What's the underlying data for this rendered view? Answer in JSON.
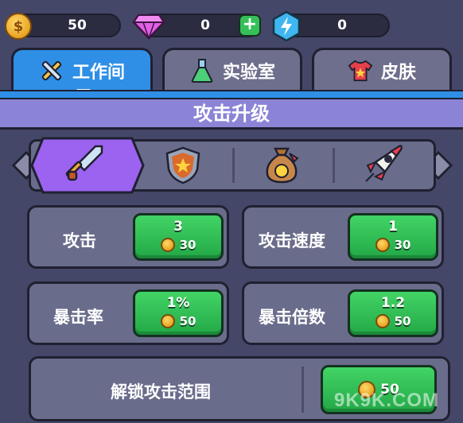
{
  "currency": {
    "coins": "50",
    "gems": "0",
    "energy": "0",
    "coin_symbol": "$"
  },
  "tabs": [
    {
      "label": "工作间",
      "icon": "tools-icon",
      "active": true
    },
    {
      "label": "实验室",
      "icon": "flask-icon",
      "active": false
    },
    {
      "label": "皮肤",
      "icon": "shirt-icon",
      "active": false
    }
  ],
  "section_title": "攻击升级",
  "categories": [
    {
      "icon": "sword-icon",
      "active": true
    },
    {
      "icon": "shield-icon",
      "active": false
    },
    {
      "icon": "money-bag-icon",
      "active": false
    },
    {
      "icon": "rocket-icon",
      "active": false
    }
  ],
  "upgrades": [
    {
      "label": "攻击",
      "level": "3",
      "cost": "30"
    },
    {
      "label": "攻击速度",
      "level": "1",
      "cost": "30"
    },
    {
      "label": "暴击率",
      "level": "1%",
      "cost": "50"
    },
    {
      "label": "暴击倍数",
      "level": "1.2",
      "cost": "50"
    }
  ],
  "unlock": {
    "label": "解锁攻击范围",
    "cost": "50"
  },
  "watermark": "9K9K.COM",
  "colors": {
    "tab_active": "#2f8fe6",
    "title_band": "#8b84d6",
    "button_green": "#36c05a",
    "panel": "#6a6c8b",
    "selector_active": "#9b63f0"
  }
}
